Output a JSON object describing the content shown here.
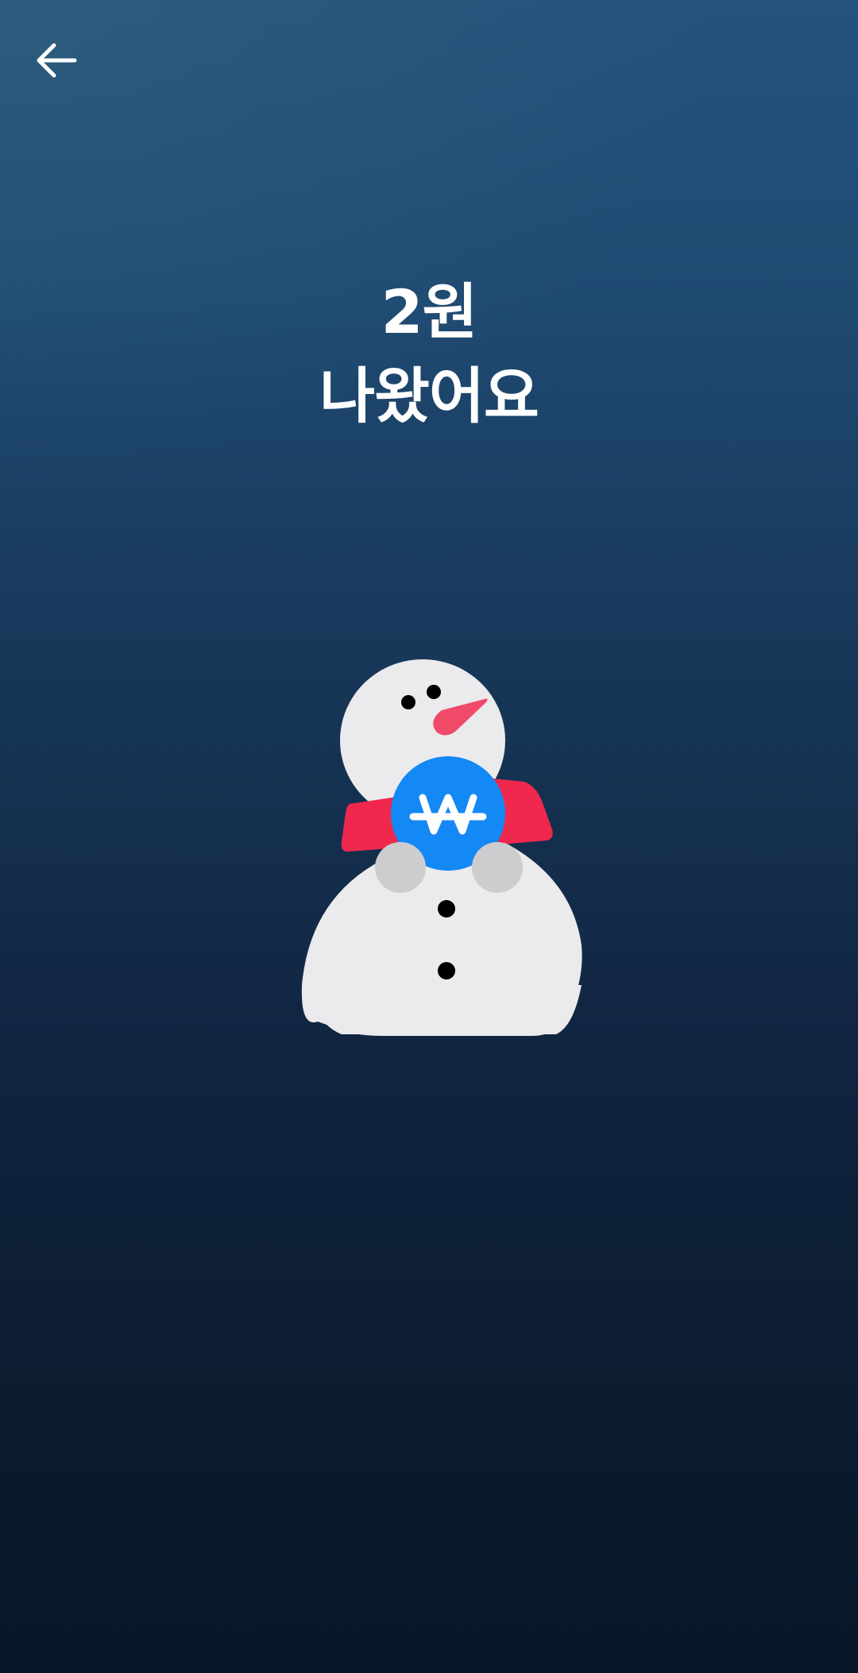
{
  "header": {
    "back_icon": "arrow-left-icon"
  },
  "result": {
    "amount_line": "2원",
    "message_line": "나왔어요"
  },
  "illustration": {
    "name": "snowman-holding-coin",
    "coin_symbol": "₩",
    "colors": {
      "snow": "#ebeaec",
      "hands": "#cdcdd0",
      "scarf": "#f0284e",
      "nose": "#f04a6a",
      "coin": "#1488f5",
      "eyes_buttons": "#000000"
    }
  },
  "theme": {
    "background_top": "#24527c",
    "background_bottom": "#081729",
    "text_color": "#ffffff"
  }
}
